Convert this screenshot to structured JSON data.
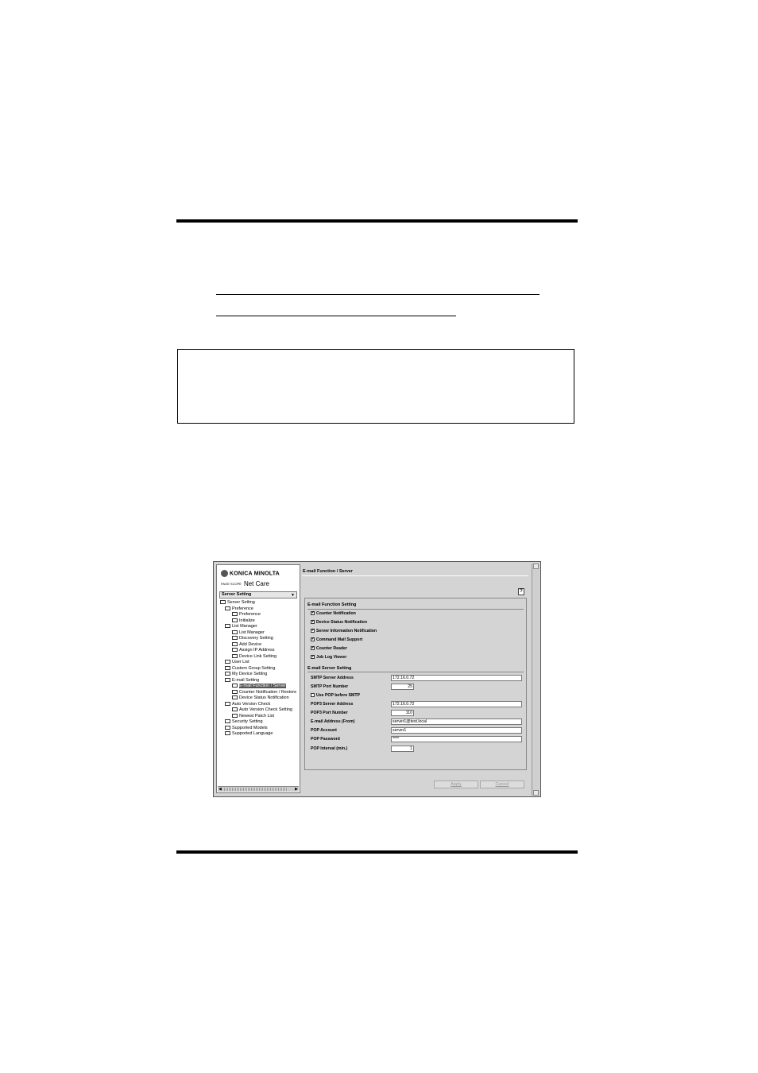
{
  "window": {
    "logo_brand": "KONICA MINOLTA",
    "logo_page_scope": "PAGE SCOPE",
    "logo_product": "Net Care",
    "selector": {
      "value": "Server Setting"
    },
    "tree": [
      {
        "label": "Server Setting",
        "level": 0,
        "icon": "folder-icon"
      },
      {
        "label": "Preference",
        "level": 1,
        "icon": "folder-icon"
      },
      {
        "label": "Preference",
        "level": 2,
        "icon": "page-icon"
      },
      {
        "label": "Initialize",
        "level": 2,
        "icon": "page-icon"
      },
      {
        "label": "List Manager",
        "level": 1,
        "icon": "folder-icon"
      },
      {
        "label": "List Manager",
        "level": 2,
        "icon": "page-icon"
      },
      {
        "label": "Discovery Setting",
        "level": 2,
        "icon": "page-icon"
      },
      {
        "label": "Add Device",
        "level": 2,
        "icon": "device-icon"
      },
      {
        "label": "Assign IP Address",
        "level": 2,
        "icon": "page-icon"
      },
      {
        "label": "Device Link Setting",
        "level": 2,
        "icon": "link-icon"
      },
      {
        "label": "User List",
        "level": 1,
        "icon": "users-icon"
      },
      {
        "label": "Custom Group Setting",
        "level": 1,
        "icon": "group-icon"
      },
      {
        "label": "My Device Setting",
        "level": 1,
        "icon": "device-icon"
      },
      {
        "label": "E-mail Setting",
        "level": 1,
        "icon": "folder-icon"
      },
      {
        "label": "E-mail Function / Server",
        "level": 2,
        "icon": "page-icon",
        "selected": true
      },
      {
        "label": "Counter Notification / Restore",
        "level": 2,
        "icon": "page-icon"
      },
      {
        "label": "Device Status Notification",
        "level": 2,
        "icon": "page-icon"
      },
      {
        "label": "Auto Version Check",
        "level": 1,
        "icon": "folder-icon"
      },
      {
        "label": "Auto Version Check Setting",
        "level": 2,
        "icon": "page-icon"
      },
      {
        "label": "Newest Patch List",
        "level": 2,
        "icon": "page-icon"
      },
      {
        "label": "Security Setting",
        "level": 1,
        "icon": "key-icon"
      },
      {
        "label": "Supported Models",
        "level": 1,
        "icon": "printer-icon"
      },
      {
        "label": "Supported Language",
        "level": 1,
        "icon": "language-icon"
      }
    ],
    "panel_title": "E-mail Function / Server",
    "help_label": "?",
    "function_section": "E-mail Function Setting",
    "checkboxes": [
      {
        "label": "Counter Notification",
        "checked": true
      },
      {
        "label": "Device Status Notification",
        "checked": true
      },
      {
        "label": "Server Information Notification",
        "checked": true
      },
      {
        "label": "Command Mail Support",
        "checked": true
      },
      {
        "label": "Counter Reader",
        "checked": true
      },
      {
        "label": "Job Log Viewer",
        "checked": true
      }
    ],
    "server_section": "E-mail Server Setting",
    "smtp_address_label": "SMTP Server Address",
    "smtp_address_value": "172.16.0.72",
    "smtp_port_label": "SMTP Port Number",
    "smtp_port_value": "25",
    "pop_before_smtp_label": "Use POP before SMTP",
    "pop_before_smtp_checked": false,
    "pop3_address_label": "POP3 Server Address",
    "pop3_address_value": "172.16.0.72",
    "pop3_port_label": "POP3 Port Number",
    "pop3_port_value": "110",
    "email_from_label": "E-mail Address (From)",
    "email_from_value": "server1@test.local",
    "pop_account_label": "POP Account",
    "pop_account_value": "server1",
    "pop_password_label": "POP Password",
    "pop_password_value": "****",
    "pop_interval_label": "POP Interval (min.)",
    "pop_interval_value": "1",
    "apply_label": "Apply",
    "cancel_label": "Cancel"
  }
}
